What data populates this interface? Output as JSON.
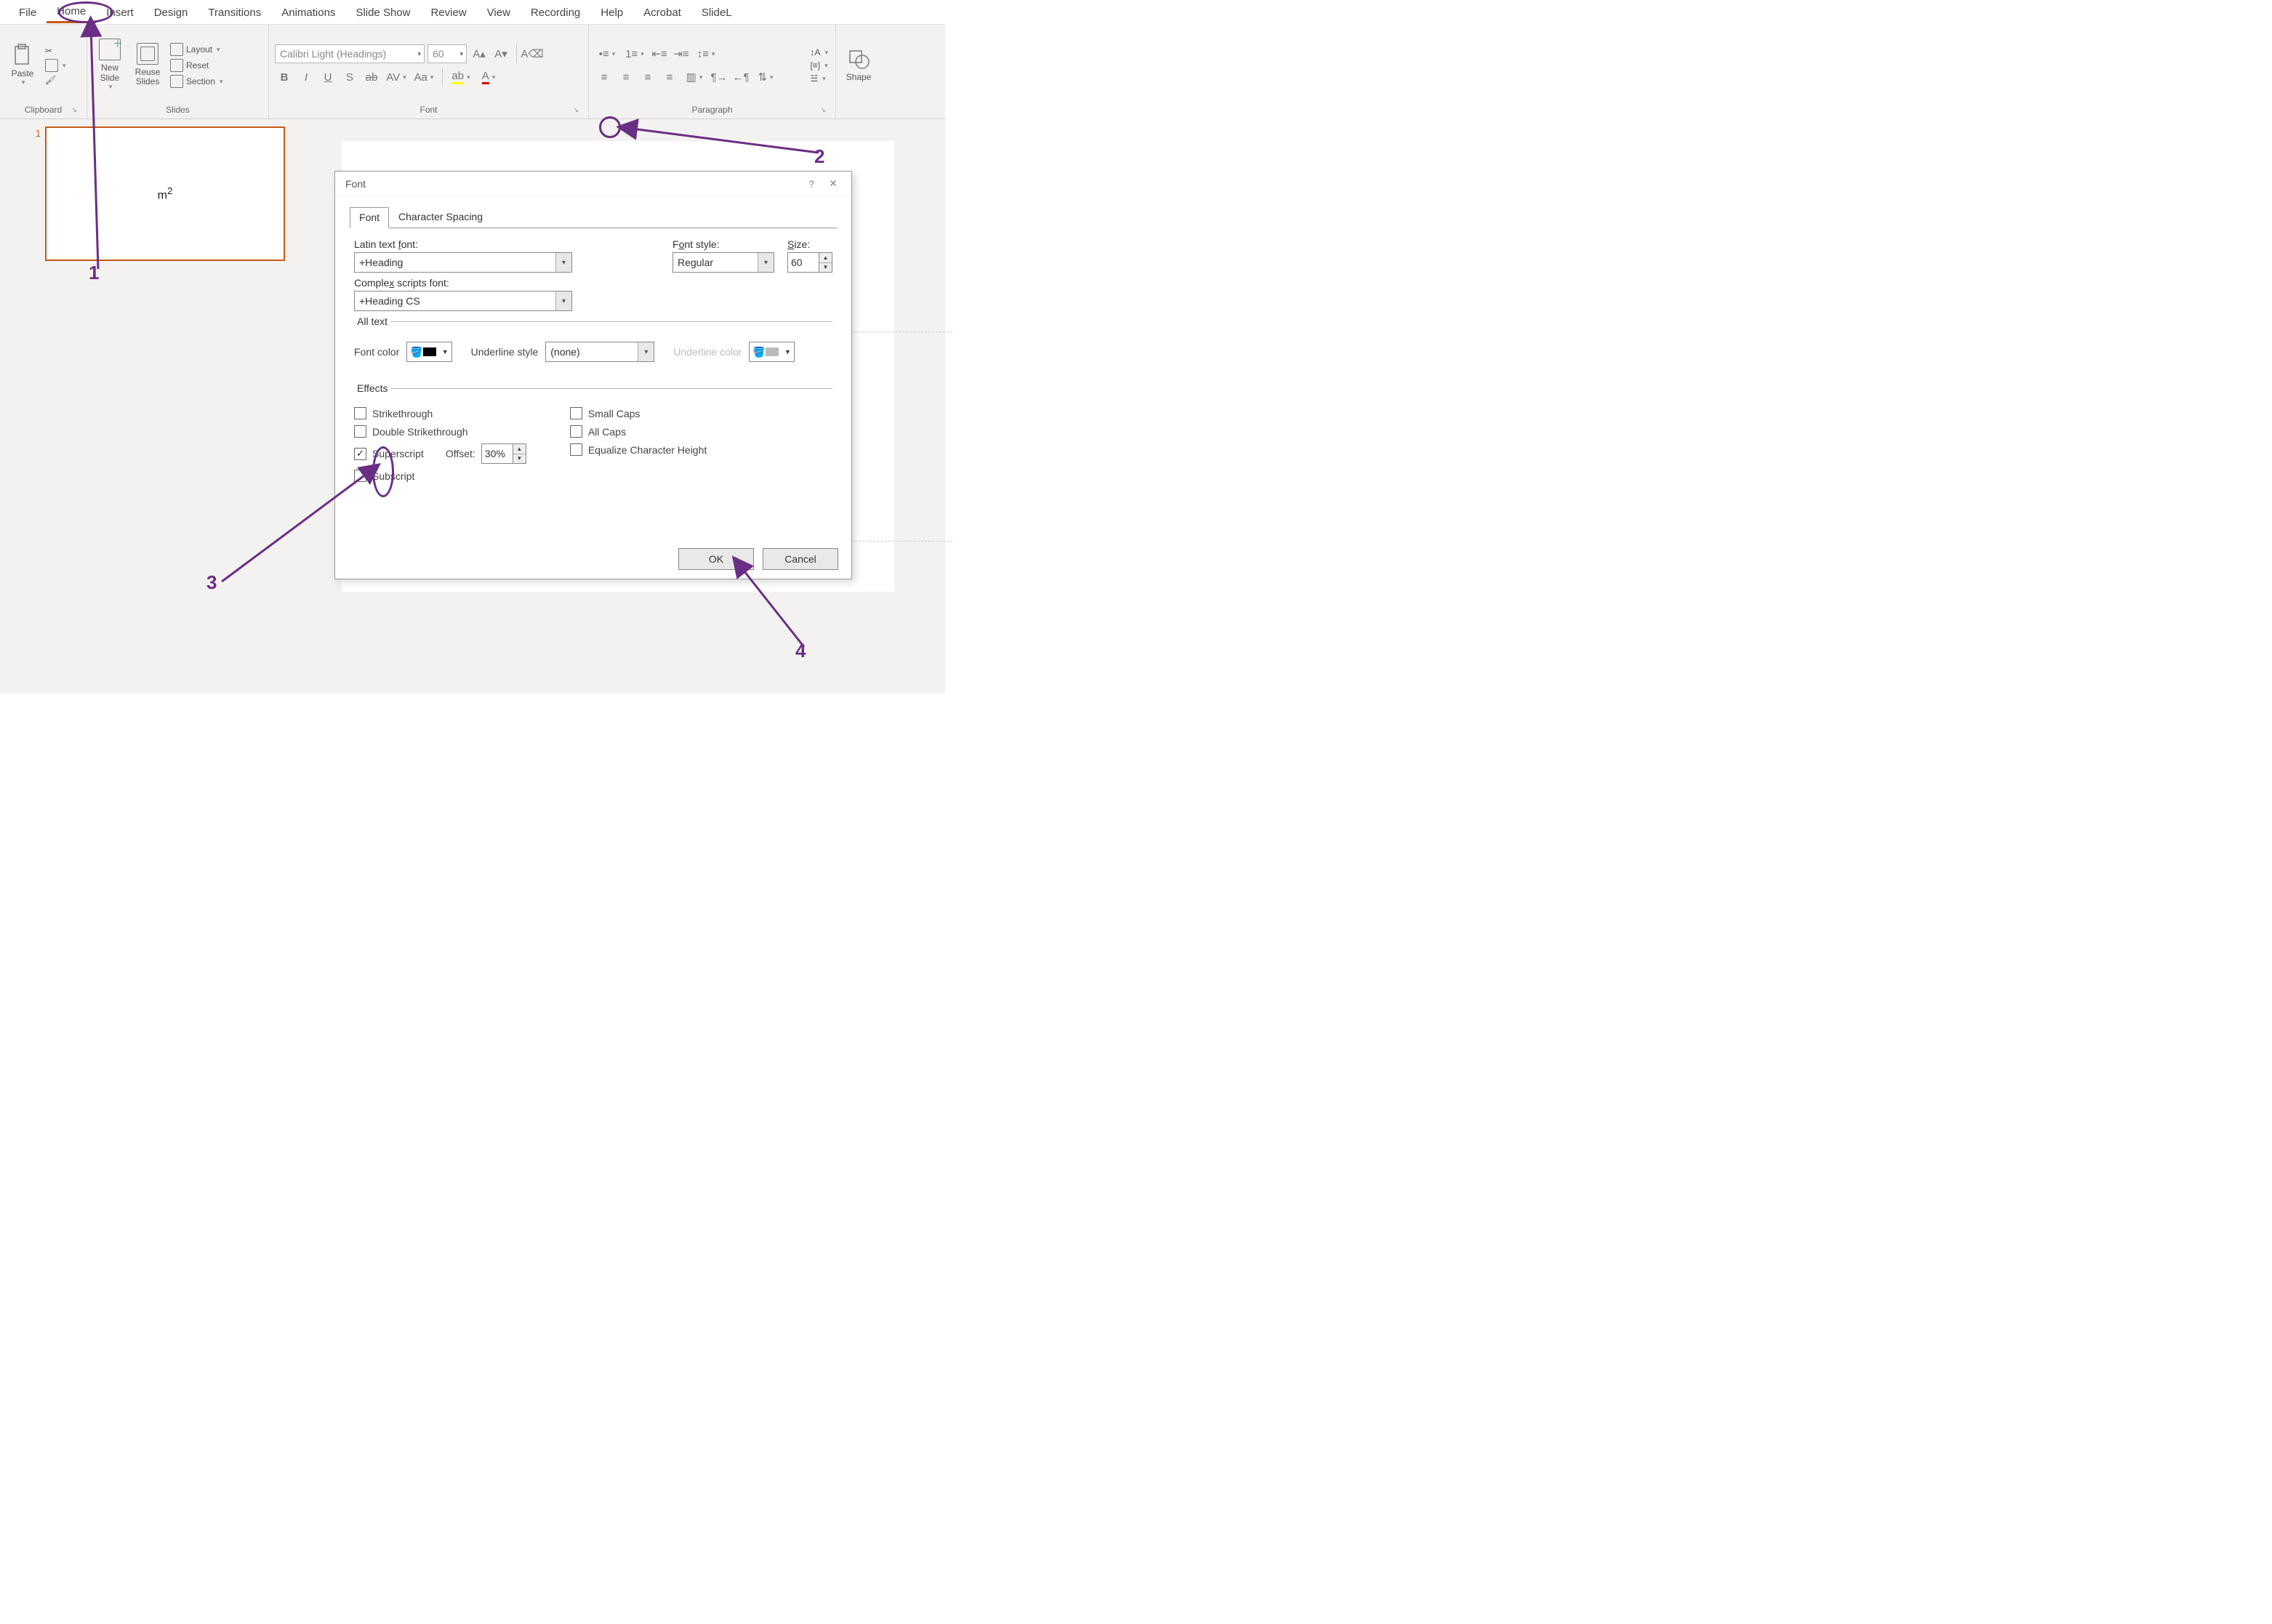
{
  "tabs": {
    "file": "File",
    "home": "Home",
    "insert": "Insert",
    "design": "Design",
    "transitions": "Transitions",
    "animations": "Animations",
    "slideshow": "Slide Show",
    "review": "Review",
    "view": "View",
    "recording": "Recording",
    "help": "Help",
    "acrobat": "Acrobat",
    "slidel": "SlideL"
  },
  "ribbon": {
    "clipboard": {
      "paste": "Paste",
      "label": "Clipboard"
    },
    "slides": {
      "new_slide": "New Slide",
      "reuse": "Reuse Slides",
      "layout": "Layout",
      "reset": "Reset",
      "section": "Section",
      "label": "Slides"
    },
    "font": {
      "font_name": "Calibri Light (Headings)",
      "font_size": "60",
      "label": "Font"
    },
    "paragraph": {
      "label": "Paragraph"
    },
    "drawing": {
      "shapes": "Shape"
    }
  },
  "thumb": {
    "number": "1",
    "content_base": "m",
    "content_sup": "2"
  },
  "dialog": {
    "title": "Font",
    "tabs": {
      "font": "Font",
      "spacing": "Character Spacing"
    },
    "latin_label": "Latin text font:",
    "latin_value": "+Heading",
    "style_label": "Font style:",
    "style_value": "Regular",
    "size_label": "Size:",
    "size_value": "60",
    "complex_label": "Complex scripts font:",
    "complex_value": "+Heading CS",
    "alltext_legend": "All text",
    "fontcolor_label": "Font color",
    "uline_style_label": "Underline style",
    "uline_style_value": "(none)",
    "uline_color_label": "Underline color",
    "effects_legend": "Effects",
    "strike": "Strikethrough",
    "dstrike": "Double Strikethrough",
    "supers": "Superscript",
    "subs": "Subscript",
    "offset_label": "Offset:",
    "offset_value": "30%",
    "smallcaps": "Small Caps",
    "allcaps": "All Caps",
    "equalize": "Equalize Character Height",
    "ok": "OK",
    "cancel": "Cancel"
  },
  "annotations": {
    "a1": "1",
    "a2": "2",
    "a3": "3",
    "a4": "4"
  }
}
